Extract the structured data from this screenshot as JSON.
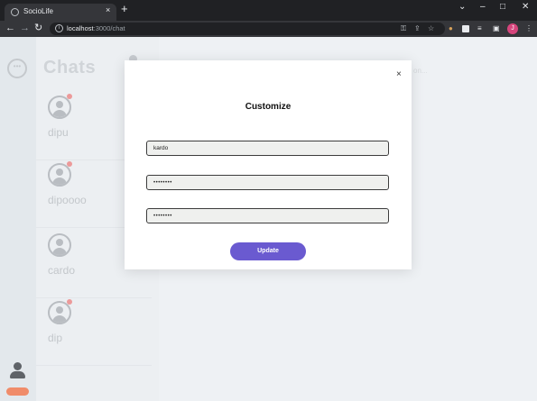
{
  "browser": {
    "tab_title": "SocioLife",
    "tab_close": "×",
    "new_tab": "+",
    "window_controls": {
      "minimize": "–",
      "maximize": "□",
      "close": "✕",
      "tab_search": "⌄"
    },
    "nav": {
      "back": "←",
      "forward": "→",
      "reload": "↻"
    },
    "url_host": "localhost",
    "url_path": ":3000/chat",
    "icons": [
      "key-icon",
      "share-icon",
      "star-icon",
      "cookie-extension-icon",
      "puzzle-extension-icon",
      "media-icon",
      "side-panel-icon",
      "profile-avatar",
      "menu-icon"
    ],
    "profile_initial": "J"
  },
  "app": {
    "sidebar_title": "Chats",
    "contacts": [
      {
        "name": "dipu",
        "online_dot": true
      },
      {
        "name": "dipoooo",
        "online_dot": true
      },
      {
        "name": "cardo",
        "online_dot": false
      },
      {
        "name": "dip",
        "online_dot": true
      }
    ],
    "main_hint": "on...",
    "rail_logo_glyph": "•••"
  },
  "modal": {
    "title": "Customize",
    "close": "×",
    "username_value": "kardo",
    "password_value": "••••••••",
    "confirm_value": "••••••••",
    "update_label": "Update"
  },
  "colors": {
    "accent": "#6a5ad0",
    "chrome_dark": "#202124",
    "chrome_toolbar": "#35363a",
    "profile": "#d6457c",
    "badge": "#f08c6a"
  }
}
